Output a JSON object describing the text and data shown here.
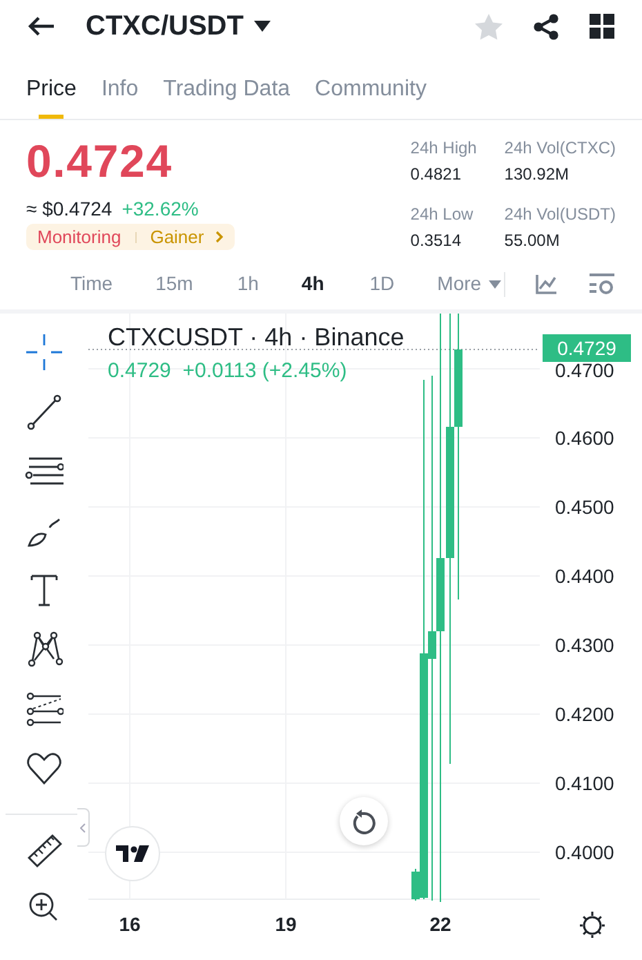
{
  "header": {
    "title": "CTXC/USDT",
    "favorite": false
  },
  "tabs": [
    {
      "label": "Price",
      "selected": true
    },
    {
      "label": "Info",
      "selected": false
    },
    {
      "label": "Trading Data",
      "selected": false
    },
    {
      "label": "Community",
      "selected": false
    }
  ],
  "price": {
    "last": "0.4724",
    "usd": "≈ $0.4724",
    "change": "+32.62%",
    "tags": [
      {
        "label": "Monitoring",
        "kind": "risk"
      },
      {
        "label": "Gainer",
        "kind": "trend"
      }
    ]
  },
  "stats": [
    {
      "label": "24h High",
      "value": "0.4821"
    },
    {
      "label": "24h Vol(CTXC)",
      "value": "130.92M"
    },
    {
      "label": "24h Low",
      "value": "0.3514"
    },
    {
      "label": "24h Vol(USDT)",
      "value": "55.00M"
    }
  ],
  "intervals": [
    {
      "label": "Time",
      "selected": false
    },
    {
      "label": "15m",
      "selected": false
    },
    {
      "label": "1h",
      "selected": false
    },
    {
      "label": "4h",
      "selected": true
    },
    {
      "label": "1D",
      "selected": false
    },
    {
      "label": "More",
      "selected": false,
      "kind": "menu"
    }
  ],
  "chart": {
    "legend": "CTXCUSDT · 4h · Binance",
    "ohlc": "0.4729  +0.0113 (+2.45%)",
    "last_price": "0.4729",
    "y_labels": [
      "0.4700",
      "0.4600",
      "0.4500",
      "0.4400",
      "0.4300",
      "0.4200",
      "0.4100",
      "0.4000"
    ],
    "x_labels": [
      "16",
      "19",
      "22"
    ]
  },
  "tools": [
    {
      "kind": "crosshair",
      "selected": true
    },
    {
      "kind": "line",
      "selected": false
    },
    {
      "kind": "channel",
      "selected": false
    },
    {
      "kind": "brush",
      "selected": false
    },
    {
      "kind": "text",
      "selected": false
    },
    {
      "kind": "pattern",
      "selected": false
    },
    {
      "kind": "fib",
      "selected": false
    },
    {
      "kind": "heart",
      "selected": false
    },
    {
      "kind": "ruler",
      "selected": false
    },
    {
      "kind": "zoom",
      "selected": false
    }
  ]
}
